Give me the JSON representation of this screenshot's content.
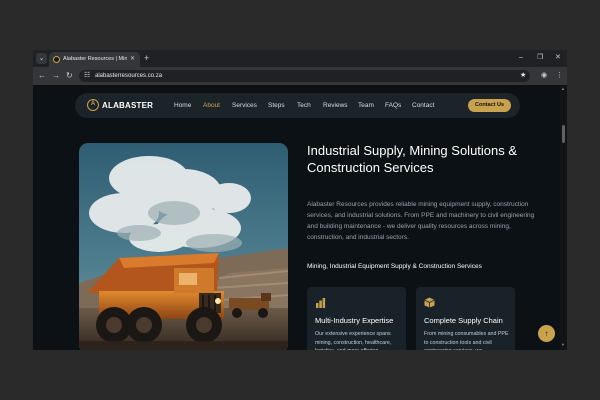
{
  "browser": {
    "tab_title": "Alabaster Resources | Mining ...",
    "url": "alabasterresources.co.za",
    "icons": {
      "tab_search": "chevron-down-icon",
      "tab_close": "close-icon",
      "new_tab": "plus-icon",
      "minimize": "minimize-icon",
      "maximize": "maximize-icon",
      "close": "close-icon",
      "back": "arrow-left-icon",
      "forward": "arrow-right-icon",
      "reload": "reload-icon",
      "site_info": "tune-icon",
      "bookmark": "star-icon",
      "profile": "profile-icon",
      "menu": "kebab-menu-icon"
    }
  },
  "site": {
    "logo_text": "ALABASTER",
    "nav": [
      "Home",
      "About",
      "Services",
      "Steps",
      "Tech",
      "Reviews",
      "Team",
      "FAQs",
      "Contact"
    ],
    "active_nav": "About",
    "contact_button": "Contact Us",
    "accent_color": "#c9a24f"
  },
  "hero": {
    "title": "Industrial Supply, Mining Solutions & Construction Services",
    "description": "Alabaster Resources provides reliable mining equipment supply, construction services, and industrial solutions. From PPE and machinery to civil engineering and building maintenance - we deliver quality resources across mining, construction, and industrial sectors.",
    "sectors": "Mining, Industrial Equipment Supply & Construction Services"
  },
  "cards": [
    {
      "icon": "bar-chart-icon",
      "title": "Multi-Industry Expertise",
      "text": "Our extensive experience spans mining, construction, healthcare, logistics, and more offering"
    },
    {
      "icon": "box-icon",
      "title": "Complete Supply Chain",
      "text": "From mining consumables and PPE to construction tools and civil engineering services, we"
    }
  ],
  "back_to_top": "↑"
}
